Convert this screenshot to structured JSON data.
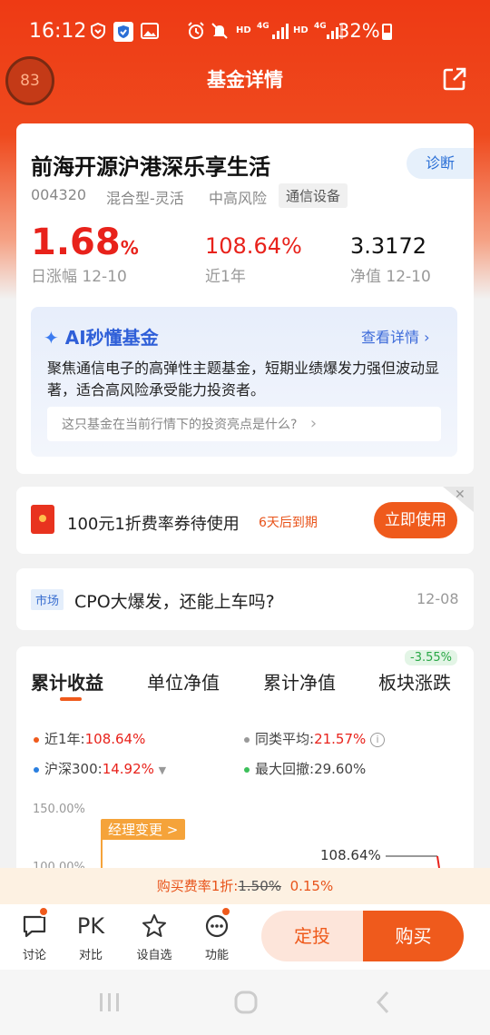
{
  "status": {
    "time": "16:12",
    "battery": "32%",
    "network_1": "HD",
    "network_1_gen": "4G",
    "network_2": "HD",
    "network_2_gen": "4G"
  },
  "nav": {
    "title": "基金详情",
    "floating_badge": "83"
  },
  "fund": {
    "name": "前海开源沪港深乐享生活",
    "diagnose": "诊断",
    "code": "004320",
    "type": "混合型-灵活",
    "risk": "中高风险",
    "sector": "通信设备",
    "daily_change": "1.68",
    "daily_change_unit": "%",
    "daily_change_label": "日涨幅 12-10",
    "year_return": "108.64%",
    "year_return_label": "近1年",
    "nav_value": "3.3172",
    "nav_label": "净值 12-10"
  },
  "ai": {
    "title": "AI秒懂基金",
    "more": "查看详情",
    "desc": "聚焦通信电子的高弹性主题基金，短期业绩爆发力强但波动显著，适合高风险承受能力投资者。",
    "question": "这只基金在当前行情下的投资亮点是什么?"
  },
  "coupon": {
    "text": "100元1折费率券待使用",
    "expire": "6天后到期",
    "button": "立即使用"
  },
  "news": {
    "tag": "市场",
    "title": "CPO大爆发，还能上车吗?",
    "date": "12-08"
  },
  "tabs": [
    {
      "label": "累计收益"
    },
    {
      "label": "单位净值"
    },
    {
      "label": "累计净值"
    },
    {
      "label": "板块涨跌"
    }
  ],
  "tab_badge": "-3.55%",
  "legend": {
    "year_label": "近1年:",
    "year_value": "108.64%",
    "peer_label": "同类平均:",
    "peer_value": "21.57%",
    "index_label": "沪深300:",
    "index_value": "14.92%",
    "drawdown_label": "最大回撤:",
    "drawdown_value": "29.60%"
  },
  "chart_data": {
    "type": "line",
    "y_ticks": [
      "150.00%",
      "100.00%"
    ],
    "manager_change": "经理变更",
    "annotation": "108.64%",
    "series": [
      {
        "name": "近1年",
        "last_value": 108.64
      }
    ]
  },
  "colors": {
    "accent": "#ef5a1c",
    "up": "#e8221b",
    "ai": "#2f5fd8",
    "down": "#28a745"
  },
  "fee": {
    "label": "购买费率1折:",
    "old": "1.50%",
    "new": "0.15%"
  },
  "bottom": {
    "discuss": "讨论",
    "pk_glyph": "PK",
    "compare": "对比",
    "watch": "设自选",
    "function": "功能",
    "auto_invest": "定投",
    "buy": "购买"
  }
}
